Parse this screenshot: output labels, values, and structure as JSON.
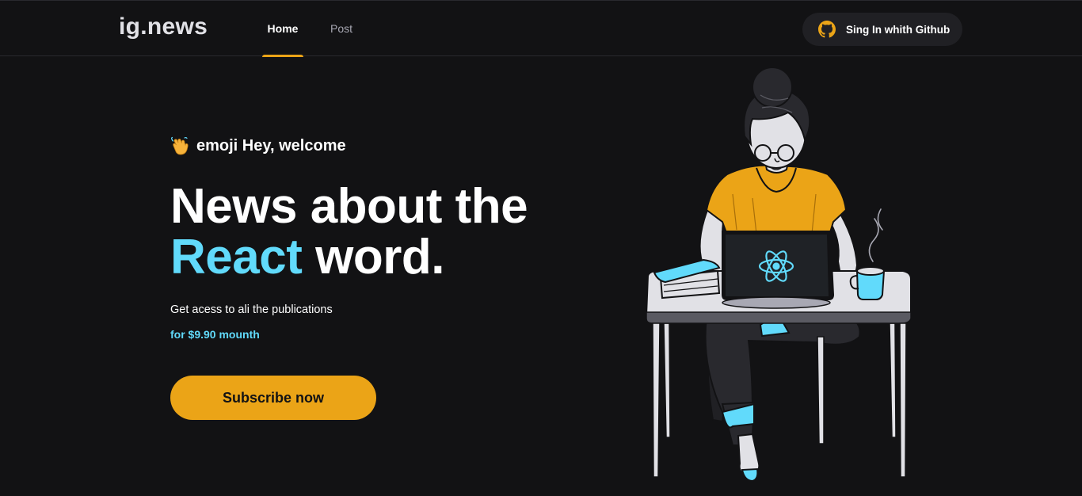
{
  "header": {
    "logo": "ig.news",
    "nav": [
      {
        "label": "Home",
        "active": true
      },
      {
        "label": "Post",
        "active": false
      }
    ],
    "signin_label": "Sing In whith Github",
    "signin_icon": "github-icon"
  },
  "main": {
    "greeting_icon": "waving-hand-icon",
    "greeting_text": "emoji Hey, welcome",
    "headline_line1": "News about the",
    "headline_accent": "React",
    "headline_rest": " word.",
    "subtitle": "Get acess to ali the publications",
    "price": "for $9.90 mounth",
    "subscribe_label": "Subscribe now",
    "illustration_icon": "woman-coding-at-desk-illustration"
  },
  "colors": {
    "background": "#121214",
    "accent_yellow": "#eba417",
    "accent_cyan": "#61dafb",
    "button_dark": "#202024"
  }
}
